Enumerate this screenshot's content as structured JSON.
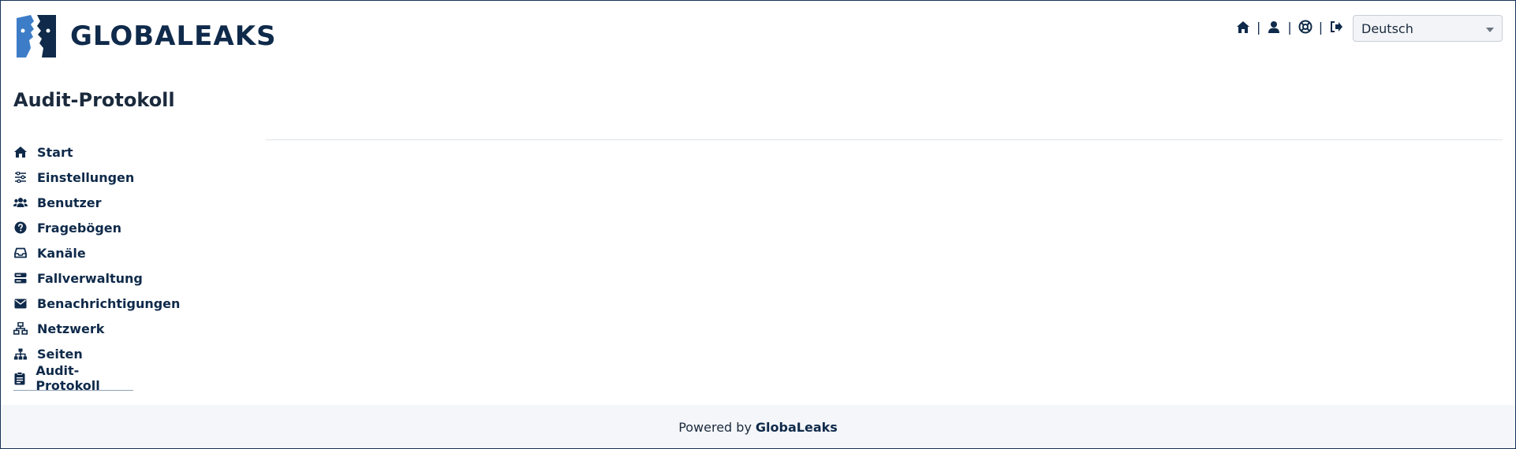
{
  "header": {
    "logo_text": "GLOBALEAKS",
    "nav_icons": [
      "home-icon",
      "user-icon",
      "support-icon",
      "logout-icon"
    ],
    "language": {
      "selected": "Deutsch"
    }
  },
  "page": {
    "title": "Audit-Protokoll"
  },
  "sidebar": {
    "items": [
      {
        "label": "Start",
        "icon": "home-icon"
      },
      {
        "label": "Einstellungen",
        "icon": "sliders-icon"
      },
      {
        "label": "Benutzer",
        "icon": "users-icon"
      },
      {
        "label": "Fragebögen",
        "icon": "question-icon"
      },
      {
        "label": "Kanäle",
        "icon": "inbox-icon"
      },
      {
        "label": "Fallverwaltung",
        "icon": "server-icon"
      },
      {
        "label": "Benachrichtigungen",
        "icon": "envelope-icon"
      },
      {
        "label": "Netzwerk",
        "icon": "network-icon"
      },
      {
        "label": "Seiten",
        "icon": "sitemap-icon"
      },
      {
        "label": "Audit-Protokoll",
        "icon": "clipboard-icon",
        "active": true
      }
    ]
  },
  "footer": {
    "prefix": "Powered by",
    "brand": "GlobaLeaks"
  },
  "colors": {
    "brand": "#0f2a4a",
    "logo_blue": "#3d7dc8",
    "footer_bg": "#f4f6f9"
  }
}
